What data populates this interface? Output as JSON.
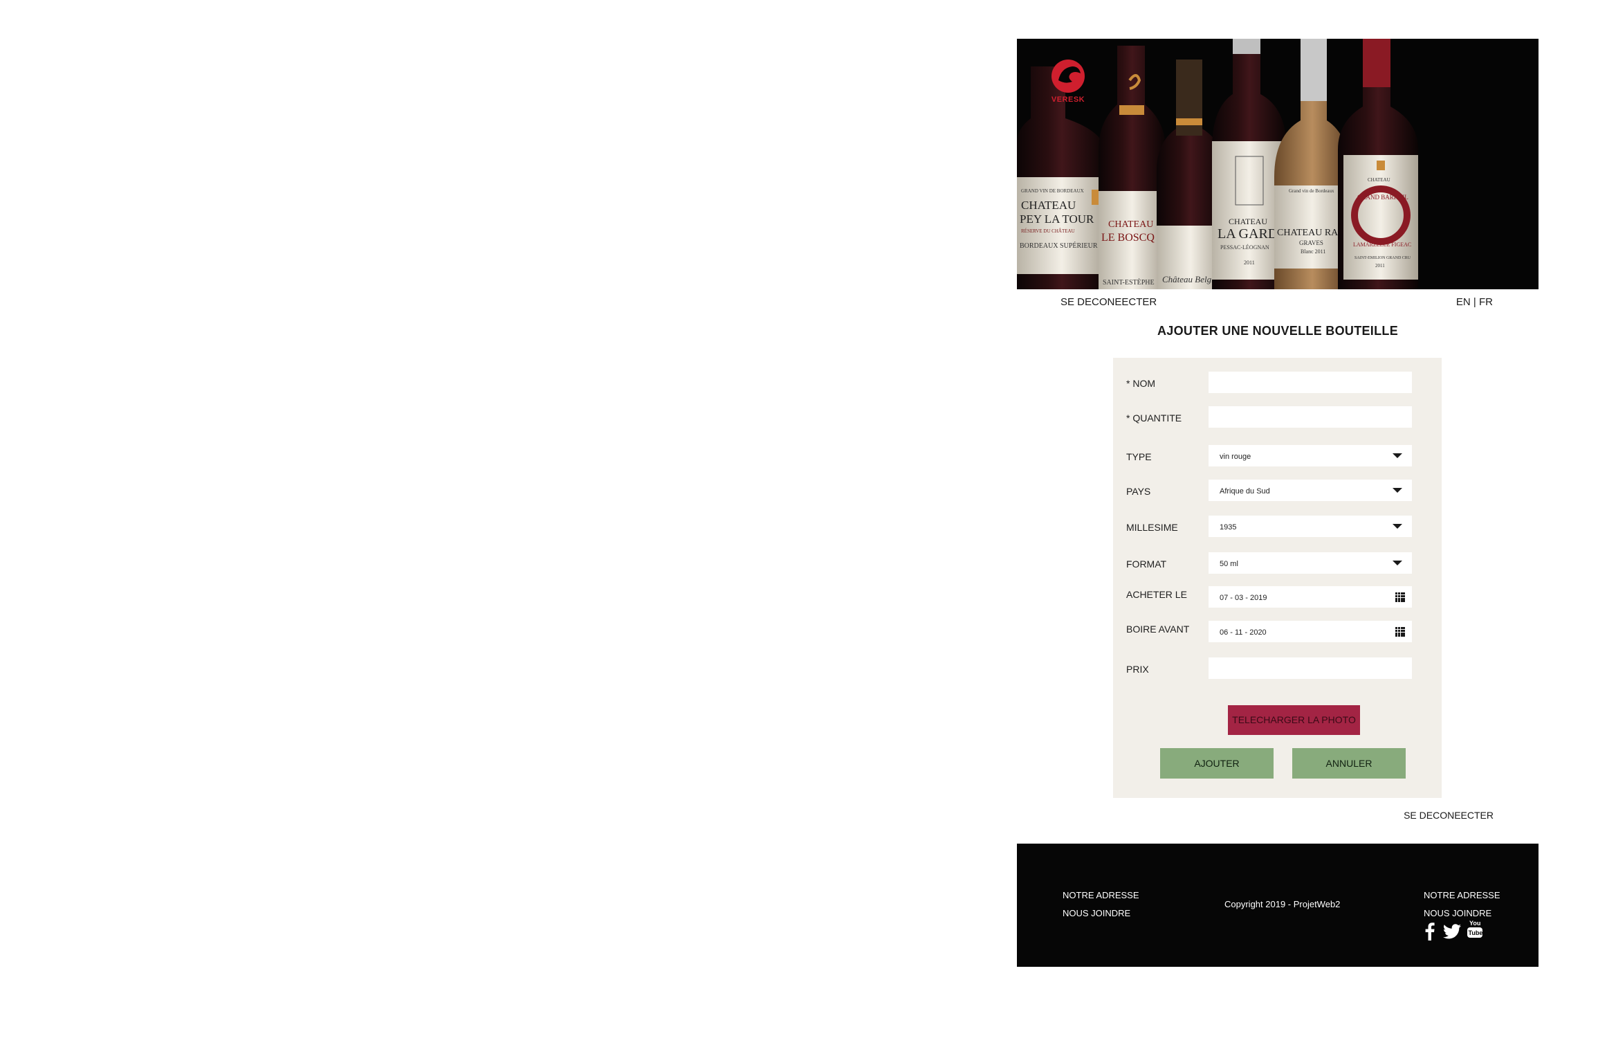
{
  "hero": {
    "brand": "VERESK",
    "bottles": [
      {
        "lines": [
          "GRAND VIN DE BORDEAUX",
          "CHATEAU",
          "PEY LA TOUR",
          "RÉSERVE DU CHÂTEAU",
          "BORDEAUX SUPÉRIEUR"
        ]
      },
      {
        "lines": [
          "CHATEAU",
          "LE BOSCQ",
          "SAINT-ESTÈPHE"
        ]
      },
      {
        "lines": [
          "Château Belgrave"
        ]
      },
      {
        "lines": [
          "CHATEAU",
          "LA GARDE",
          "PESSAC-LÉOGNAN",
          "2011"
        ]
      },
      {
        "lines": [
          "Grand vin de Bordeaux",
          "CHATEAU RAHOUL",
          "GRAVES",
          "Blanc 2011"
        ]
      },
      {
        "lines": [
          "CHATEAU",
          "GRAND BARRAIL",
          "LAMARZELLE FIGEAC",
          "SAINT-EMILION GRAND CRU",
          "2011"
        ]
      }
    ]
  },
  "nav": {
    "logout": "SE DECONEECTER",
    "lang_en": "EN",
    "lang_sep": "|",
    "lang_fr": "FR"
  },
  "form": {
    "title": "AJOUTER UNE  NOUVELLE BOUTEILLE",
    "fields": {
      "nom": {
        "label": "* NOM",
        "value": ""
      },
      "quantite": {
        "label": "* QUANTITE",
        "value": ""
      },
      "type": {
        "label": "TYPE",
        "value": "vin rouge"
      },
      "pays": {
        "label": "PAYS",
        "value": "Afrique du Sud"
      },
      "millesime": {
        "label": "MILLESIME",
        "value": "1935"
      },
      "format": {
        "label": "FORMAT",
        "value": "50 ml"
      },
      "acheter_le": {
        "label": "ACHETER LE",
        "value": "07 - 03 - 2019"
      },
      "boire_avant": {
        "label": "BOIRE AVANT",
        "value": "06 - 11 - 2020"
      },
      "prix": {
        "label": "PRIX",
        "value": ""
      }
    },
    "upload_label": "TELECHARGER LA PHOTO",
    "submit_label": "AJOUTER",
    "cancel_label": "ANNULER"
  },
  "bottom_logout": "SE DECONEECTER",
  "footer": {
    "left_links": [
      "NOTRE ADRESSE",
      "NOUS JOINDRE"
    ],
    "copyright": "Copyright 2019 - ProjetWeb2",
    "right_links": [
      "NOTRE ADRESSE",
      "NOUS JOINDRE"
    ],
    "social": [
      "facebook-icon",
      "twitter-icon",
      "youtube-icon"
    ],
    "youtube_text_top": "You",
    "youtube_text_bottom": "Tube"
  },
  "colors": {
    "accent_photo": "#a32444",
    "button_green": "#88ab7c",
    "form_bg": "#f2efe9",
    "footer_bg": "#060606",
    "logo_red": "#cf1f2e"
  }
}
